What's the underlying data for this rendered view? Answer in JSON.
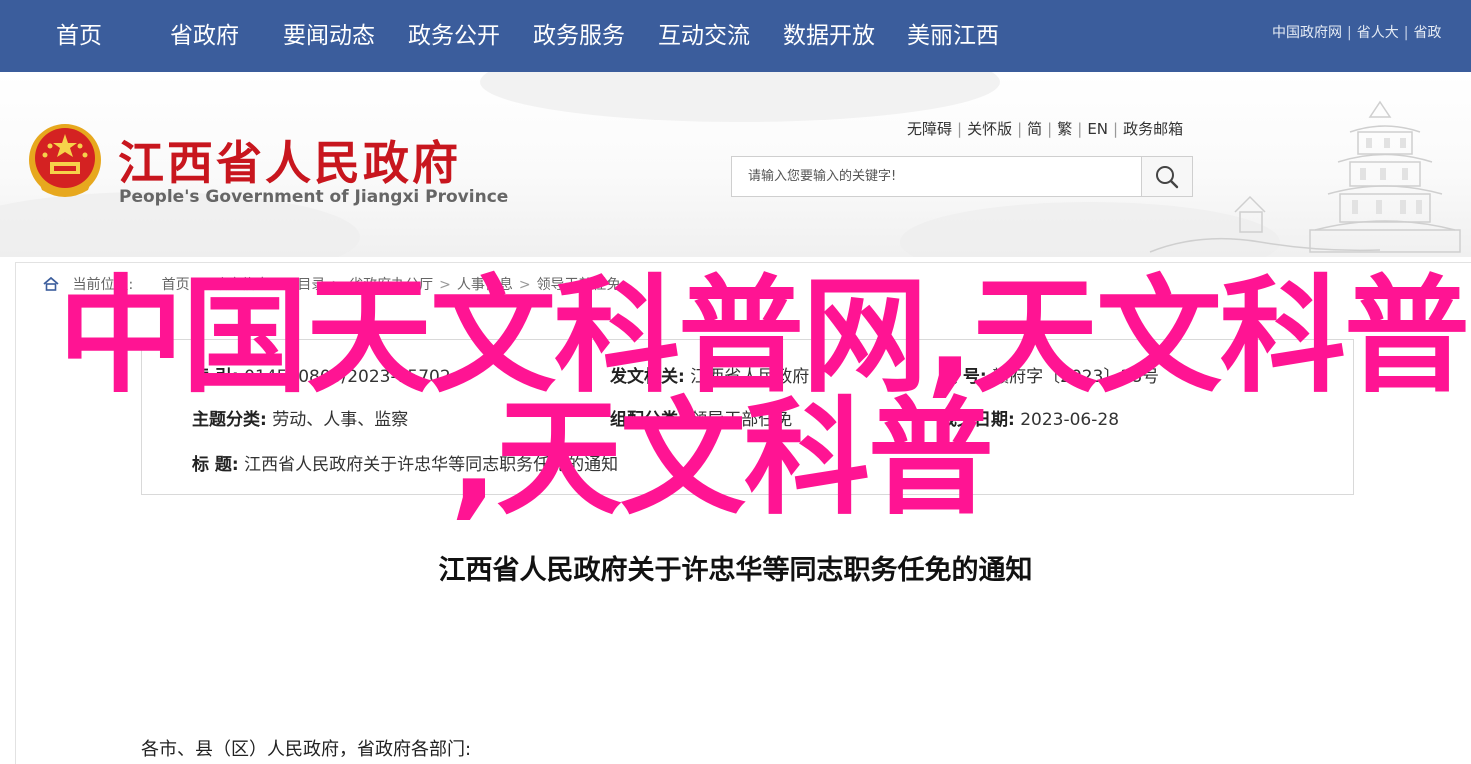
{
  "nav": {
    "items": [
      "首页",
      "省政府",
      "要闻动态",
      "政务公开",
      "政务服务",
      "互动交流",
      "数据开放",
      "美丽江西"
    ]
  },
  "top_links": [
    "中国政府网",
    "省人大",
    "省政"
  ],
  "header": {
    "logo_cn": "江西省人民政府",
    "logo_en": "People's Government of Jiangxi Province",
    "util_links": [
      "无障碍",
      "关怀版",
      "简",
      "繁",
      "EN",
      "政务邮箱"
    ],
    "search": {
      "placeholder": "请输入您要输入的关键字!"
    }
  },
  "breadcrumb": {
    "label": "当前位置:",
    "items": [
      "首页",
      "政府信息公开目录",
      "省政府办公厅",
      "人事信息",
      "领导干部任免"
    ]
  },
  "meta": {
    "index_label": "索  引:",
    "index_value": "014500800/2023-75702",
    "issuer_label": "发文机关:",
    "issuer_value": "江西省人民政府",
    "docno_label": "文    号:",
    "docno_value": "赣府字〔2023〕38号",
    "topic_label": "主题分类:",
    "topic_value": "劳动、人事、监察",
    "genre_label": "组配分类:",
    "genre_value": "领导干部任免",
    "date_label": "成文日期:",
    "date_value": "2023-06-28",
    "title_label": "标        题:",
    "title_value": "江西省人民政府关于许忠华等同志职务任免的通知"
  },
  "document": {
    "title": "江西省人民政府关于许忠华等同志职务任免的通知",
    "salutation": "各市、县（区）人民政府，省政府各部门:"
  },
  "overlay": {
    "line1": "中国天文科普网,天文科普",
    "line2": ",天文科普"
  },
  "colors": {
    "nav_bg": "#3b5d9c",
    "logo_red": "#c8161e",
    "overlay_pink": "#ff1493"
  }
}
